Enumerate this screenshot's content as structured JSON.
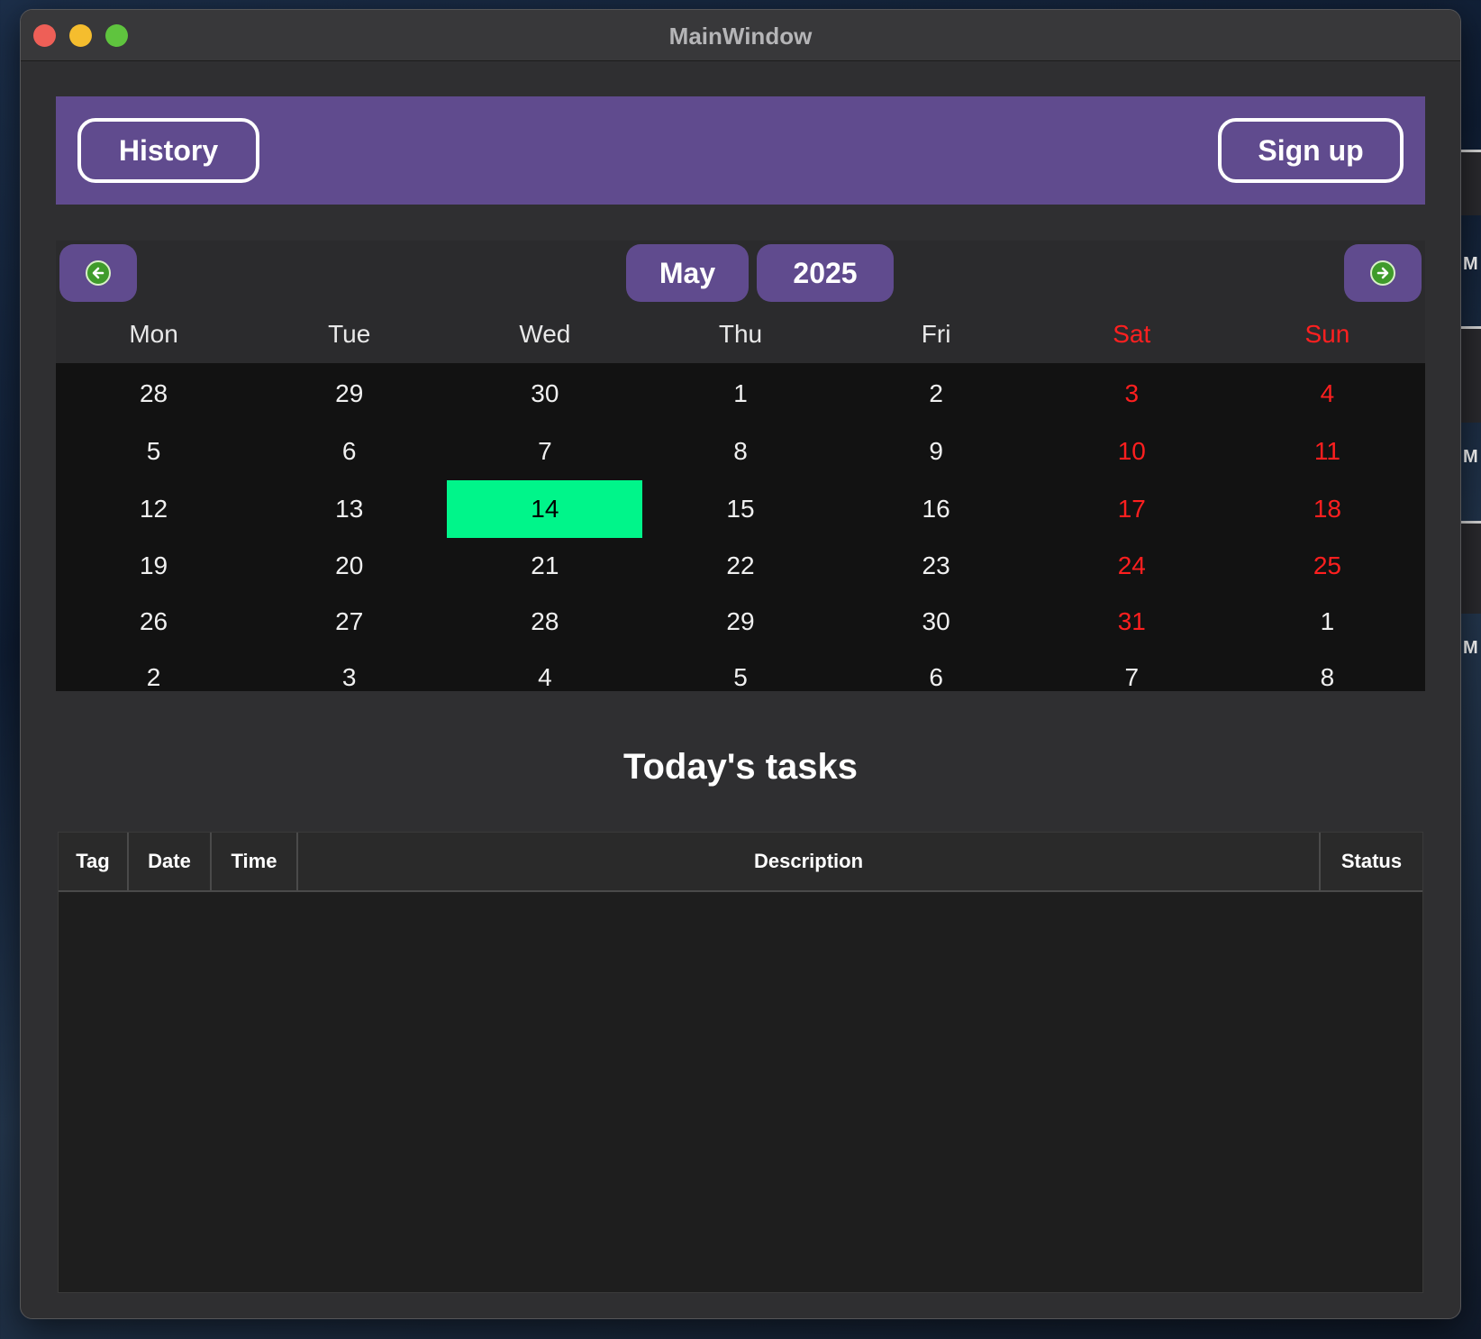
{
  "window": {
    "title": "MainWindow"
  },
  "header": {
    "history_label": "History",
    "signup_label": "Sign up"
  },
  "calendar": {
    "prev_icon": "arrow-left-circle-icon",
    "next_icon": "arrow-right-circle-icon",
    "month": "May",
    "year": "2025",
    "weekdays": [
      "Mon",
      "Tue",
      "Wed",
      "Thu",
      "Fri",
      "Sat",
      "Sun"
    ],
    "weeks": [
      [
        "28",
        "29",
        "30",
        "1",
        "2",
        "3",
        "4"
      ],
      [
        "5",
        "6",
        "7",
        "8",
        "9",
        "10",
        "11"
      ],
      [
        "12",
        "13",
        "14",
        "15",
        "16",
        "17",
        "18"
      ],
      [
        "19",
        "20",
        "21",
        "22",
        "23",
        "24",
        "25"
      ],
      [
        "26",
        "27",
        "28",
        "29",
        "30",
        "31",
        "1"
      ],
      [
        "2",
        "3",
        "4",
        "5",
        "6",
        "7",
        "8"
      ]
    ],
    "selected_day": "14",
    "colors": {
      "accent": "#604b8e",
      "weekend": "#ff1f1f",
      "selected": "#00f58a"
    }
  },
  "tasks": {
    "title": "Today's tasks",
    "columns": [
      "Tag",
      "Date",
      "Time",
      "Description",
      "Status"
    ],
    "rows": []
  }
}
